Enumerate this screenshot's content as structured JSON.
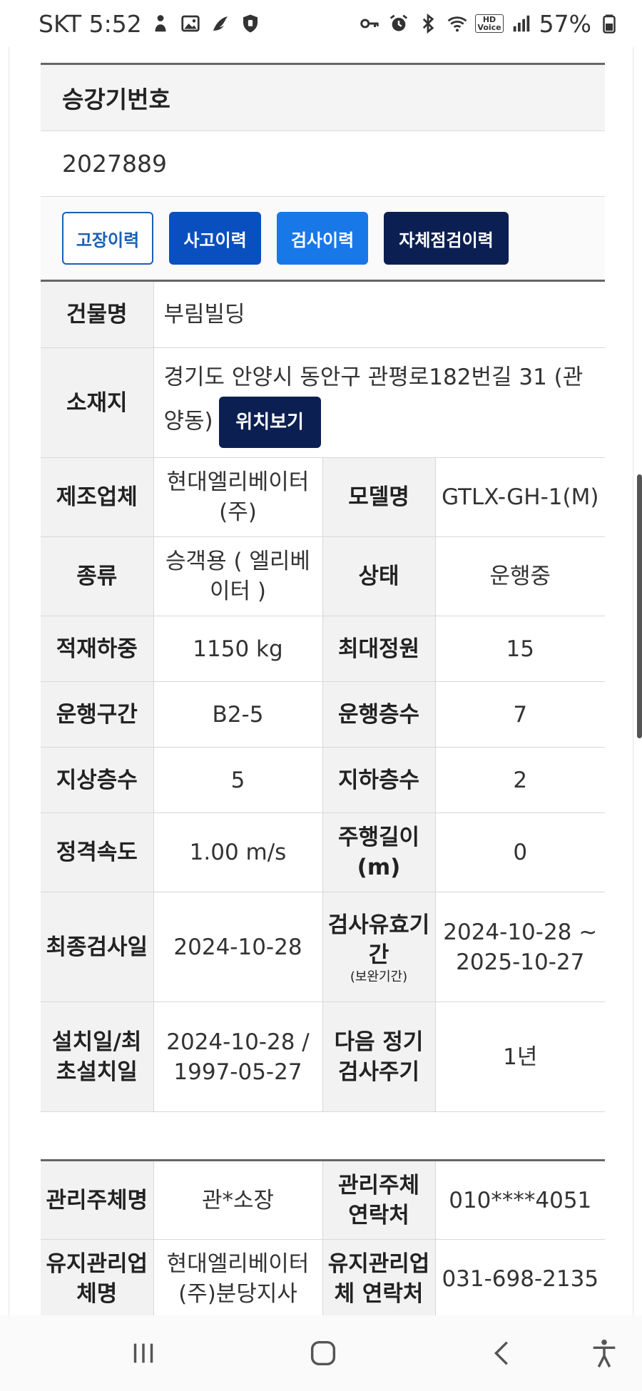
{
  "status_bar": {
    "carrier_time": "SKT 5:52",
    "battery": "57%",
    "hd_label": "HD",
    "voice_label": "Voice"
  },
  "elevator": {
    "label": "승강기번호",
    "number": "2027889"
  },
  "history_buttons": {
    "failure": "고장이력",
    "accident": "사고이력",
    "inspection": "검사이력",
    "self_check": "자체점검이력"
  },
  "info": {
    "building_label": "건물명",
    "building_value": "부림빌딩",
    "location_label": "소재지",
    "location_value": "경기도 안양시 동안구 관평로182번길 31 (관양동)",
    "location_button": "위치보기",
    "manufacturer_label": "제조업체",
    "manufacturer_value": "현대엘리베이터(주)",
    "model_label": "모델명",
    "model_value": "GTLX-GH-1(M)",
    "type_label": "종류",
    "type_value": "승객용 ( 엘리베이터 )",
    "status_label": "상태",
    "status_value": "운행중",
    "load_label": "적재하중",
    "load_value": "1150 kg",
    "capacity_label": "최대정원",
    "capacity_value": "15",
    "section_label": "운행구간",
    "section_value": "B2-5",
    "floors_label": "운행층수",
    "floors_value": "7",
    "above_label": "지상층수",
    "above_value": "5",
    "below_label": "지하층수",
    "below_value": "2",
    "speed_label": "정격속도",
    "speed_value": "1.00 m/s",
    "travel_label": "주행길이 (m)",
    "travel_value": "0",
    "last_insp_label": "최종검사일",
    "last_insp_value": "2024-10-28",
    "valid_label": "검사유효기간",
    "valid_note": "(보완기간)",
    "valid_value": "2024-10-28 ~ 2025-10-27",
    "install_label": "설치일/최초설치일",
    "install_value": "2024-10-28 / 1997-05-27",
    "cycle_label": "다음 정기 검사주기",
    "cycle_value": "1년"
  },
  "management": {
    "manager_label": "관리주체명",
    "manager_value": "관*소장",
    "manager_contact_label": "관리주체 연락처",
    "manager_contact_value": "010****4051",
    "maint_label": "유지관리업체명",
    "maint_value": "현대엘리베이터(주)분당지사",
    "maint_contact_label": "유지관리업체 연락처",
    "maint_contact_value": "031-698-2135"
  },
  "icons": {
    "status_left": [
      "person-icon",
      "image-icon",
      "bird-icon",
      "shield-icon"
    ],
    "status_right": [
      "key-icon",
      "alarm-icon",
      "bluetooth-icon",
      "wifi-icon",
      "signal-icon",
      "battery-icon"
    ],
    "nav": [
      "recents-icon",
      "home-icon",
      "back-icon",
      "accessibility-icon"
    ]
  }
}
